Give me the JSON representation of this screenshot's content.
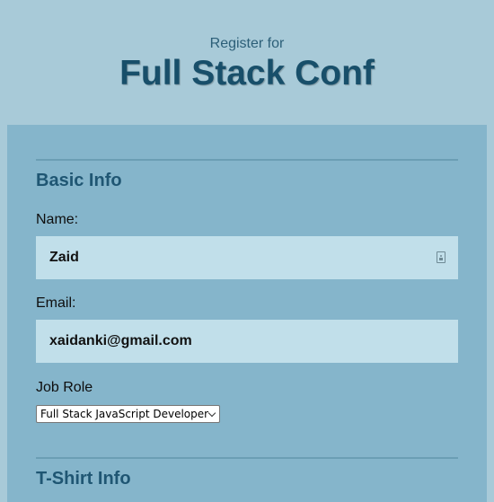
{
  "header": {
    "pretitle": "Register for",
    "title": "Full Stack Conf"
  },
  "basic_info": {
    "section_title": "Basic Info",
    "name_label": "Name:",
    "name_value": "Zaid",
    "email_label": "Email:",
    "email_value": "xaidanki@gmail.com",
    "job_role_label": "Job Role",
    "job_role_selected": "Full Stack JavaScript Developer"
  },
  "tshirt_info": {
    "section_title": "T-Shirt Info"
  },
  "colors": {
    "page_background": "#a8cad8",
    "panel_background": "#85b5cb",
    "input_background": "#c1dfea",
    "heading": "#184f6a"
  },
  "icons": {
    "name_field_icon": "contact-card-icon",
    "select_arrow": "chevron-down-icon"
  }
}
